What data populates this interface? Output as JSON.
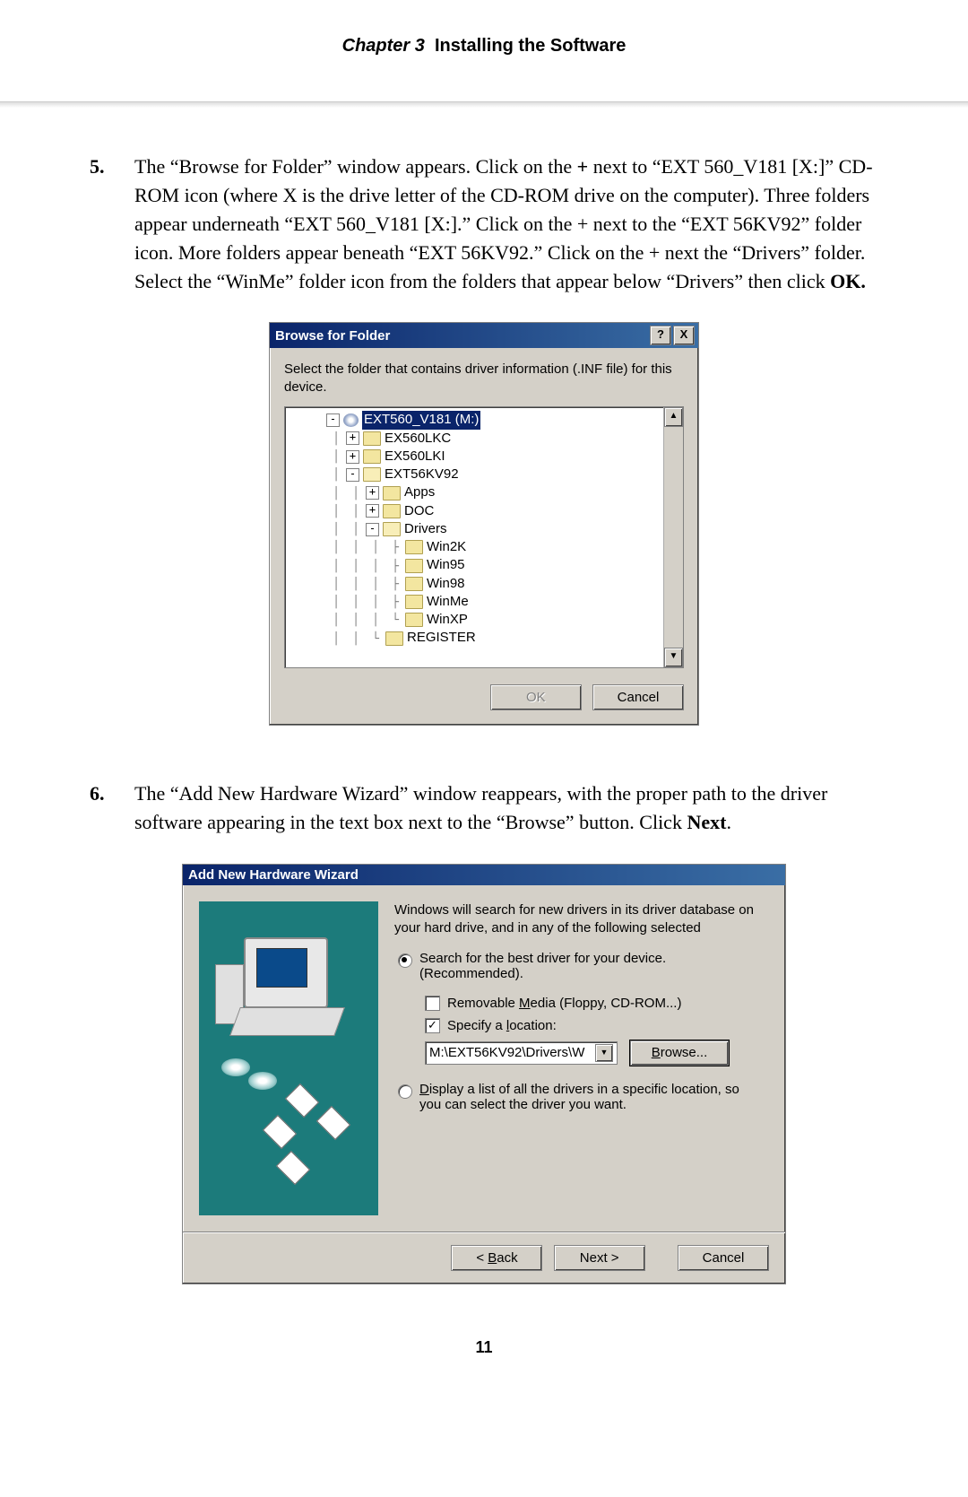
{
  "header": {
    "chapter": "Chapter 3",
    "title": "Installing the Software"
  },
  "step5": {
    "num": "5.",
    "p1": "The “Browse for Folder” window appears. Click on the ",
    "plus1": "+",
    "p2": " next to “EXT 560_V181 [X:]” CD-ROM icon (where X is the drive letter of the CD-ROM drive on the computer). Three folders appear underneath “EXT 560_V181 [X:].” Click on the + next to the “EXT 56KV92” folder icon. More folders appear beneath “EXT 56KV92.” Click on the + next the “Drivers” folder. Select the “WinMe” folder icon from the folders that appear below “Drivers” then click ",
    "ok": "OK."
  },
  "dialog1": {
    "title": "Browse for Folder",
    "help": "?",
    "close": "X",
    "instruction": "Select the folder that contains driver information (.INF file) for this device.",
    "tree": {
      "root": "EXT560_V181 (M:)",
      "n1": "EX560LKC",
      "n2": "EX560LKI",
      "n3": "EXT56KV92",
      "n3a": "Apps",
      "n3b": "DOC",
      "n3c": "Drivers",
      "n3c1": "Win2K",
      "n3c2": "Win95",
      "n3c3": "Win98",
      "n3c4": "WinMe",
      "n3c5": "WinXP",
      "n3d": "REGISTER"
    },
    "up": "▲",
    "down": "▼",
    "ok": "OK",
    "cancel": "Cancel"
  },
  "step6": {
    "num": "6.",
    "p1": "The “Add New Hardware Wizard” window reappears, with the proper path to the driver software appearing in the text box next to the “Browse” button. Click ",
    "next": "Next",
    "p2": "."
  },
  "dialog2": {
    "title": "Add New Hardware Wizard",
    "intro": "Windows will search for new drivers in its driver database on your hard drive, and in any of the following selected",
    "opt1a": "Search for the best driver for your device.",
    "opt1b": "(Recommended).",
    "chk1_pre": "Removable ",
    "chk1_u": "M",
    "chk1_post": "edia (Floppy, CD-ROM...)",
    "chk2_pre": "Specify a ",
    "chk2_u": "l",
    "chk2_post": "ocation:",
    "chk2_mark": "✓",
    "path": "M:\\EXT56KV92\\Drivers\\W",
    "combo_arrow": "▼",
    "browse_u": "B",
    "browse_post": "rowse...",
    "opt2_u": "D",
    "opt2a": "isplay a list of all the drivers in a specific location, so",
    "opt2b": "you can select the driver you want.",
    "back_lt": "< ",
    "back_u": "B",
    "back_post": "ack",
    "next": "Next >",
    "cancel": "Cancel"
  },
  "page_number": "11"
}
